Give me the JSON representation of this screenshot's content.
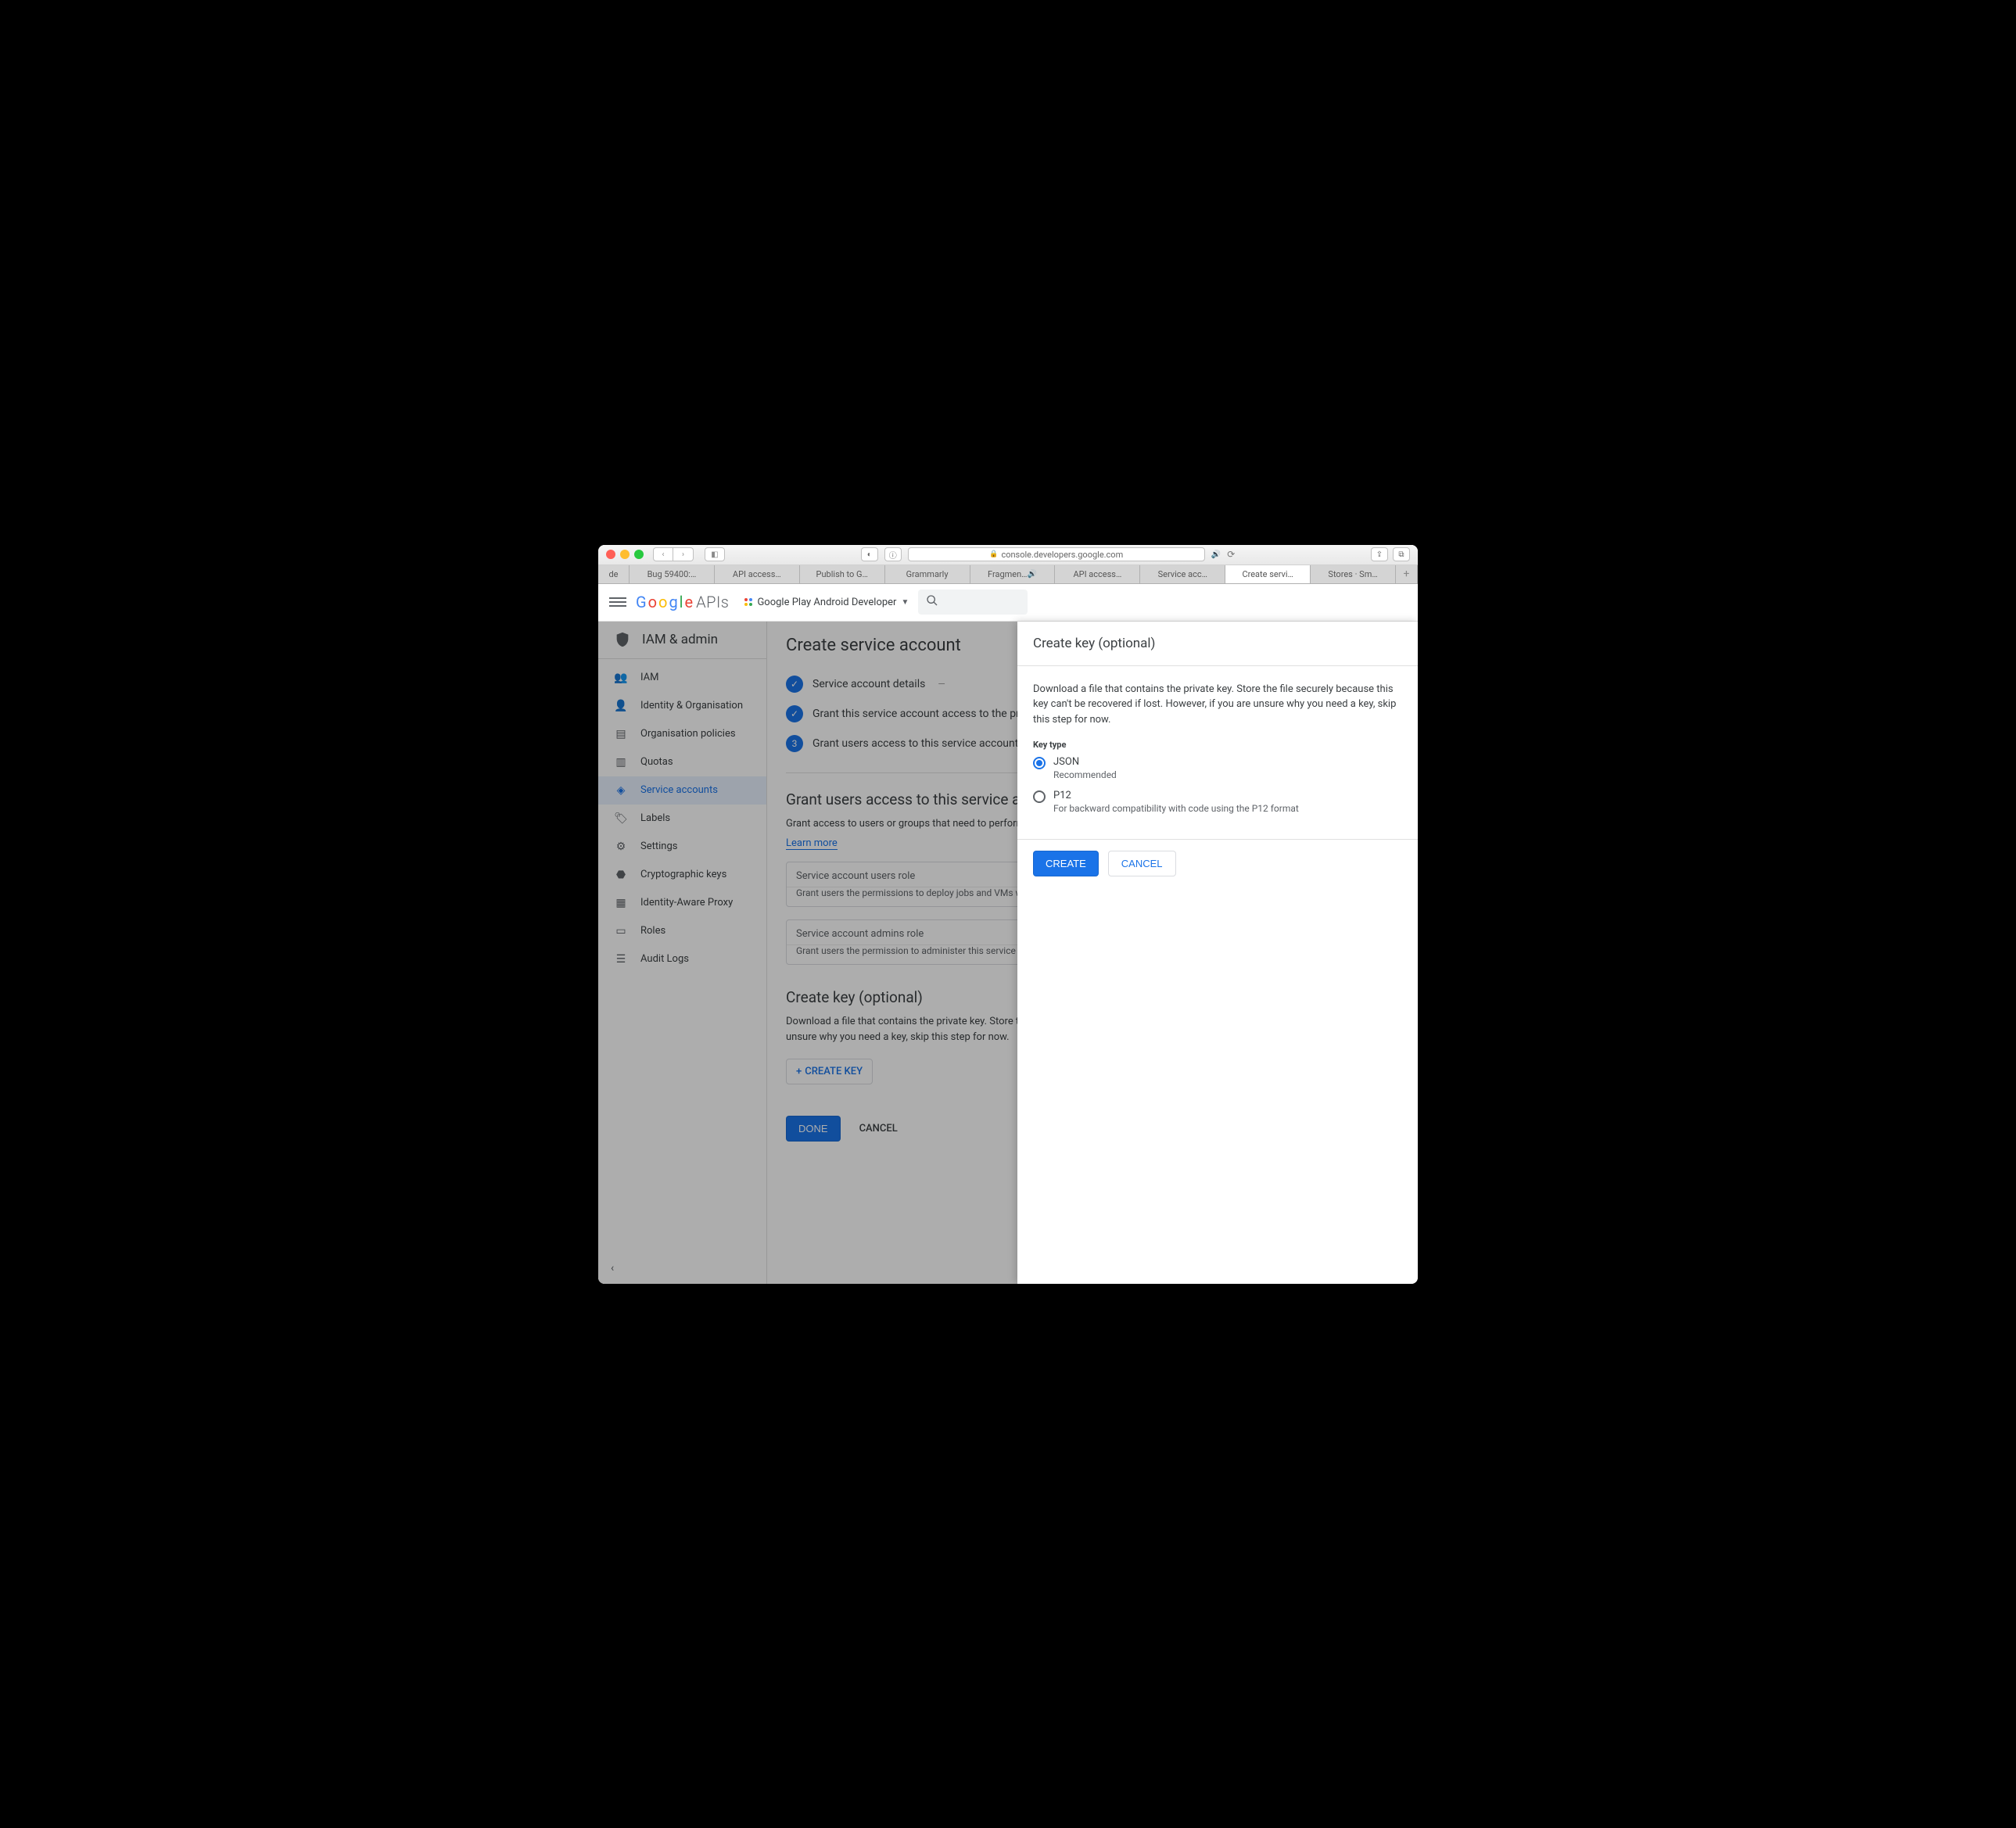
{
  "browser": {
    "url": "console.developers.google.com",
    "tabs": [
      "de",
      "Bug 59400:…",
      "API access…",
      "Publish to G…",
      "Grammarly",
      "Fragmen…",
      "API access…",
      "Service acc…",
      "Create servi…",
      "Stores · Sm…"
    ]
  },
  "header": {
    "logo_prefix": "Google",
    "logo_suffix": "APIs",
    "project": "Google Play Android Developer"
  },
  "sidebar": {
    "title": "IAM & admin",
    "items": [
      {
        "label": "IAM"
      },
      {
        "label": "Identity & Organisation"
      },
      {
        "label": "Organisation policies"
      },
      {
        "label": "Quotas"
      },
      {
        "label": "Service accounts"
      },
      {
        "label": "Labels"
      },
      {
        "label": "Settings"
      },
      {
        "label": "Cryptographic keys"
      },
      {
        "label": "Identity-Aware Proxy"
      },
      {
        "label": "Roles"
      },
      {
        "label": "Audit Logs"
      }
    ]
  },
  "steps": {
    "s1": "Service account details",
    "s2": "Grant this service account access to the project",
    "s3_num": "3",
    "s3": "Grant users access to this service account (optional)"
  },
  "main": {
    "title": "Create service account",
    "grant_heading": "Grant users access to this service account (optional)",
    "grant_desc": "Grant access to users or groups that need to perform actions as this service account.",
    "learn_more": "Learn more",
    "field1_label": "Service account users role",
    "field1_hint": "Grant users the permissions to deploy jobs and VMs with this service account",
    "field2_label": "Service account admins role",
    "field2_hint": "Grant users the permission to administer this service account",
    "createkey_heading": "Create key (optional)",
    "createkey_desc": "Download a file that contains the private key. Store the file securely because this key can't be recovered if lost. However, if you are unsure why you need a key, skip this step for now.",
    "createkey_btn": "CREATE KEY",
    "done_btn": "DONE",
    "cancel_btn": "CANCEL"
  },
  "drawer": {
    "title": "Create key (optional)",
    "desc": "Download a file that contains the private key. Store the file securely because this key can't be recovered if lost. However, if you are unsure why you need a key, skip this step for now.",
    "keytype_label": "Key type",
    "json_label": "JSON",
    "json_sub": "Recommended",
    "p12_label": "P12",
    "p12_sub": "For backward compatibility with code using the P12 format",
    "create_btn": "CREATE",
    "cancel_btn": "CANCEL"
  }
}
